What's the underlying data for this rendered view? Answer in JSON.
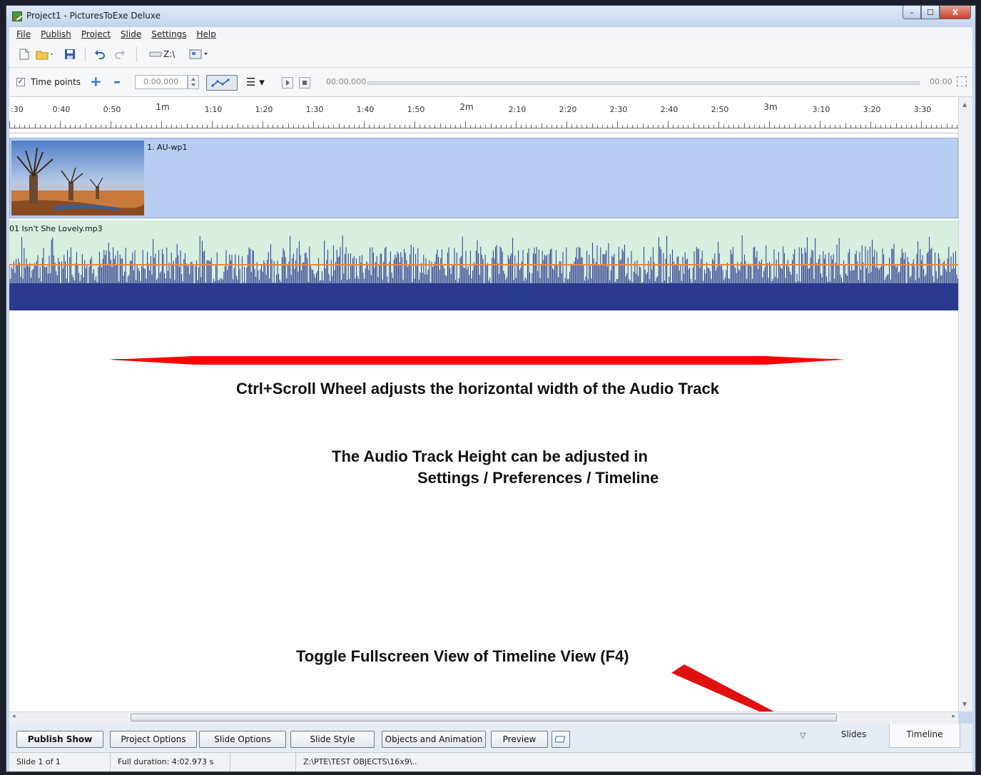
{
  "window": {
    "title": "Project1 - PicturesToExe Deluxe",
    "controls": {
      "minimize": "–",
      "maximize": "☐",
      "close": "X"
    }
  },
  "menu": [
    "File",
    "Publish",
    "Project",
    "Slide",
    "Settings",
    "Help"
  ],
  "toolbar1": {
    "icons": [
      "new-file-icon",
      "open-folder-icon",
      "save-icon",
      "undo-icon",
      "redo-icon",
      "drive-icon",
      "view-icon"
    ],
    "drive_label": "Z:\\"
  },
  "toolbar2": {
    "timepoints_checked": true,
    "timepoints_label": "Time points",
    "time_value": "0:00.000",
    "playback_start": "00:00.000",
    "playback_end": "00:00"
  },
  "ruler": {
    "labels": [
      ":30",
      "0:40",
      "0:50",
      "1m",
      "1:10",
      "1:20",
      "1:30",
      "1:40",
      "1:50",
      "2m",
      "2:10",
      "2:20",
      "2:30",
      "2:40",
      "2:50",
      "3m",
      "3:10",
      "3:20",
      "3:30"
    ]
  },
  "slide_track": {
    "label": "1. AU-wp1"
  },
  "audio_track": {
    "filename": "01 Isn't She Lovely.mp3"
  },
  "annotations": {
    "width_hint": "Ctrl+Scroll Wheel adjusts the horizontal width of the Audio Track",
    "height_line1": "The Audio Track Height can be adjusted in",
    "height_line2": "Settings / Preferences / Timeline",
    "toggle_hint": "Toggle Fullscreen View of Timeline View (F4)"
  },
  "bottom_buttons": {
    "publish": "Publish Show",
    "project_options": "Project Options",
    "slide_options": "Slide Options",
    "slide_style": "Slide Style",
    "objects_animation": "Objects and Animation",
    "preview": "Preview"
  },
  "tabs": {
    "slides": "Slides",
    "timeline": "Timeline",
    "active": "Timeline"
  },
  "status": {
    "slide": "Slide 1 of 1",
    "duration": "Full duration: 4:02.973 s",
    "path": "Z:\\PTE\\TEST OBJECTS\\16x9\\.."
  },
  "colors": {
    "slide_track": "#b7cdf2",
    "audio_bg": "#d8eedf",
    "waveform": "#2b3a8f",
    "level_line": "#e8893a",
    "arrow": "#ff0000"
  }
}
